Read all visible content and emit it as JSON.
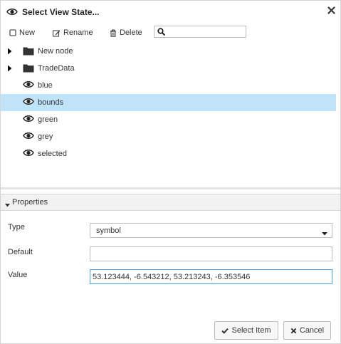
{
  "dialog": {
    "title": "Select View State...",
    "close_icon": "close-x-icon"
  },
  "toolbar": {
    "new_label": "New",
    "rename_label": "Rename",
    "delete_label": "Delete",
    "search_value": ""
  },
  "tree": {
    "items": [
      {
        "label": "New node",
        "type": "folder",
        "expandable": true,
        "selected": false
      },
      {
        "label": "TradeData",
        "type": "folder",
        "expandable": true,
        "selected": false
      },
      {
        "label": "blue",
        "type": "view-state",
        "expandable": false,
        "selected": false
      },
      {
        "label": "bounds",
        "type": "view-state",
        "expandable": false,
        "selected": true
      },
      {
        "label": "green",
        "type": "view-state",
        "expandable": false,
        "selected": false
      },
      {
        "label": "grey",
        "type": "view-state",
        "expandable": false,
        "selected": false
      },
      {
        "label": "selected",
        "type": "view-state",
        "expandable": false,
        "selected": false
      }
    ]
  },
  "properties": {
    "header_label": "Properties",
    "type_label": "Type",
    "type_value": "symbol",
    "default_label": "Default",
    "default_value": "",
    "value_label": "Value",
    "value_value": "53.123444, -6.543212, 53.213243, -6.353546"
  },
  "buttons": {
    "select_label": "Select Item",
    "cancel_label": "Cancel"
  },
  "colors": {
    "selected_row": "#bfe4fa",
    "active_border": "#4aa3d9"
  }
}
